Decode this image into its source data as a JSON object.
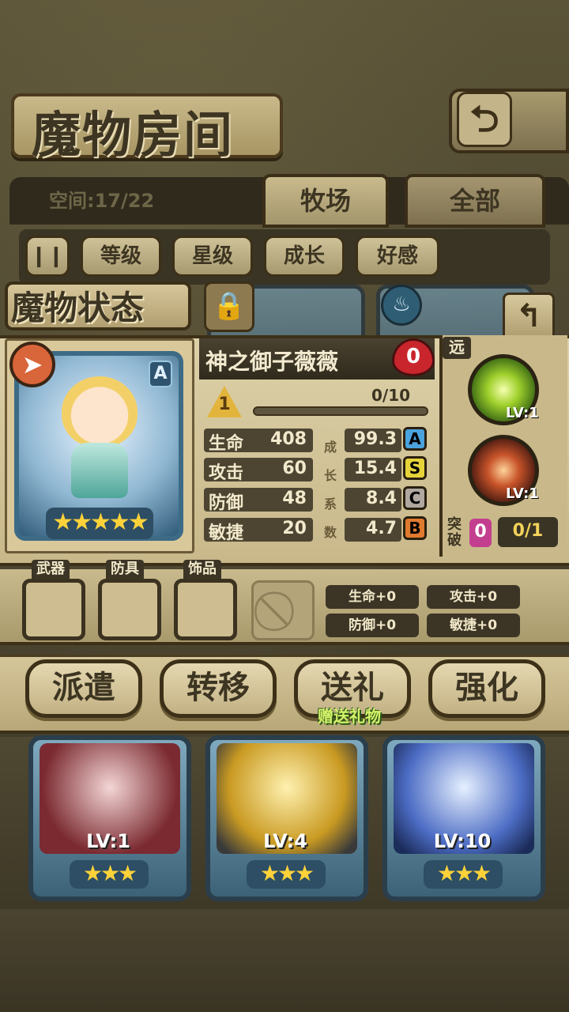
{
  "header": {
    "title": "魔物房间",
    "back_icon": "return-arrow-icon"
  },
  "tabs": {
    "space_label": "空间:17/22",
    "ranch": "牧场",
    "all": "全部"
  },
  "filters": {
    "pause_icon": "pause-icon",
    "items": [
      "等级",
      "星级",
      "成长",
      "好感"
    ]
  },
  "status": {
    "title": "魔物状态",
    "lock_icon": "padlock-icon",
    "back_icon": "return-arrow-icon"
  },
  "monster": {
    "name": "神之御子薇薇",
    "rank": "A",
    "stars": "★★★★★",
    "type_icon": "arrow-type-icon",
    "affection": "0",
    "level": "1",
    "exp": "0/10",
    "stats": [
      {
        "label": "生命",
        "value": "408",
        "growth": "99.3",
        "grade": "A",
        "grade_color": "#4aa3dd"
      },
      {
        "label": "攻击",
        "value": "60",
        "growth": "15.4",
        "grade": "S",
        "grade_color": "#e6d33a"
      },
      {
        "label": "防御",
        "value": "48",
        "growth": "8.4",
        "grade": "C",
        "grade_color": "#b0a8a0"
      },
      {
        "label": "敏捷",
        "value": "20",
        "growth": "4.7",
        "grade": "B",
        "grade_color": "#e07a2e"
      }
    ],
    "growth_chars": [
      "成",
      "长",
      "系",
      "数"
    ]
  },
  "skills": {
    "range": "远",
    "items": [
      {
        "icon": "light-burst-skill-icon",
        "lv": "LV:1"
      },
      {
        "icon": "fist-strike-skill-icon",
        "lv": "LV:1"
      }
    ],
    "break_label": "突破",
    "break_count": "0",
    "break_progress": "0/1"
  },
  "equipment": {
    "weapon": "武器",
    "armor": "防具",
    "accessory": "饰品",
    "disabled_icon": "prohibited-icon",
    "bonuses": [
      "生命+0",
      "攻击+0",
      "防御+0",
      "敏捷+0"
    ]
  },
  "actions": {
    "dispatch": "派遣",
    "transfer": "转移",
    "gift": "送礼",
    "gift_sub": "赠送礼物",
    "enhance": "强化"
  },
  "cards": [
    {
      "lv": "LV:1",
      "stars": "★★★"
    },
    {
      "lv": "LV:4",
      "stars": "★★★"
    },
    {
      "lv": "LV:10",
      "stars": "★★★"
    }
  ],
  "colors": {
    "accent_gold": "#ffd23a",
    "panel_bg": "#ddd0a8",
    "dark_brown": "#3d3018"
  }
}
